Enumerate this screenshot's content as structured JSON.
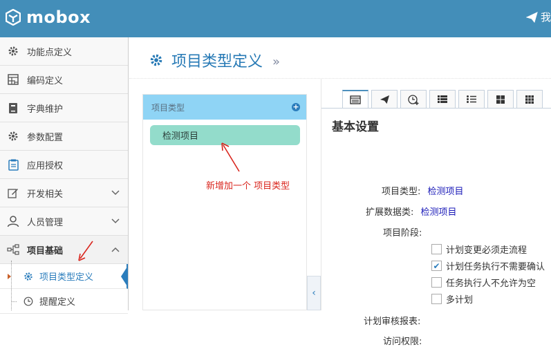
{
  "app": {
    "logo_text": "mobox",
    "top_right_label": "我"
  },
  "sidebar": {
    "items": [
      {
        "label": "功能点定义",
        "icon": "gear-icon"
      },
      {
        "label": "编码定义",
        "icon": "barcode-grid-icon"
      },
      {
        "label": "字典维护",
        "icon": "book-icon"
      },
      {
        "label": "参数配置",
        "icon": "gear-icon"
      },
      {
        "label": "应用授权",
        "icon": "clipboard-icon"
      },
      {
        "label": "开发相关",
        "icon": "edit-icon"
      },
      {
        "label": "人员管理",
        "icon": "user-icon"
      },
      {
        "label": "项目基础",
        "icon": "org-tree-icon"
      }
    ],
    "sub_items": [
      {
        "label": "项目类型定义",
        "icon": "gear-icon"
      },
      {
        "label": "提醒定义",
        "icon": "clock-icon"
      }
    ]
  },
  "page": {
    "title": "项目类型定义",
    "breadcrumb_sep": "»"
  },
  "left_panel": {
    "header": "项目类型",
    "node_label": "检测项目",
    "annotation": "新增加一个 项目类型",
    "collapse_icon": "‹"
  },
  "right_panel": {
    "tabs": [
      "card-icon",
      "paper-plane-icon",
      "clock-add-icon",
      "list-icon",
      "bullet-list-icon",
      "grid-2x2-icon",
      "grid-3x3-icon"
    ],
    "section_title": "基本设置",
    "fields": {
      "type_label": "项目类型:",
      "type_value": "检测项目",
      "ext_label": "扩展数据类:",
      "ext_value": "检测项目",
      "stage_label": "项目阶段:",
      "review_label": "计划审核报表:",
      "access_label": "访问权限:"
    },
    "checkboxes": [
      {
        "label": "计划变更必须走流程",
        "checked": false
      },
      {
        "label": "计划任务执行不需要确认",
        "checked": true
      },
      {
        "label": "任务执行人不允许为空",
        "checked": false
      },
      {
        "label": "多计划",
        "checked": false
      }
    ]
  },
  "colors": {
    "topbar": "#438eb9",
    "accent": "#2b7dbc",
    "node": "#93dccb",
    "annotation": "#d9251d"
  }
}
